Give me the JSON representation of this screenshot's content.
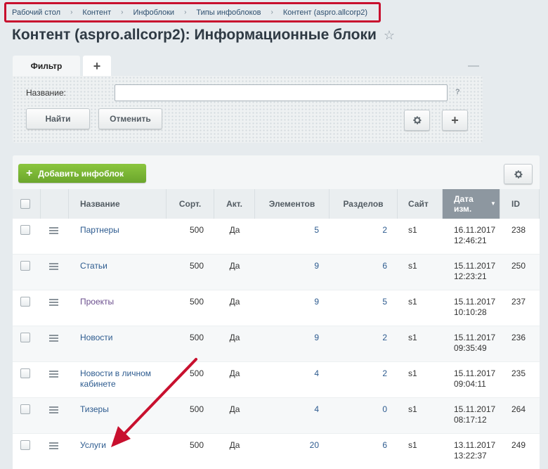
{
  "breadcrumb": [
    "Рабочий стол",
    "Контент",
    "Инфоблоки",
    "Типы инфоблоков",
    "Контент (aspro.allcorp2)"
  ],
  "breadcrumb_separator": "›",
  "page_title": "Контент (aspro.allcorp2): Информационные блоки",
  "filter": {
    "tab_label": "Фильтр",
    "add_tab_label": "+",
    "minimize_label": "—",
    "name_label": "Название:",
    "name_value": "",
    "help_label": "?",
    "find_button": "Найти",
    "cancel_button": "Отменить",
    "plus_button": "+"
  },
  "toolbar": {
    "add_button": "Добавить инфоблок",
    "add_plus": "+"
  },
  "table": {
    "columns": [
      "Название",
      "Сорт.",
      "Акт.",
      "Элементов",
      "Разделов",
      "Сайт",
      "Дата изм.",
      "ID"
    ],
    "sorted_column": "Дата изм.",
    "rows": [
      {
        "name": "Партнеры",
        "sort": "500",
        "active": "Да",
        "elements": "5",
        "sections": "2",
        "site": "s1",
        "date": "16.11.2017 12:46:21",
        "id": "238"
      },
      {
        "name": "Статьи",
        "sort": "500",
        "active": "Да",
        "elements": "9",
        "sections": "6",
        "site": "s1",
        "date": "15.11.2017 12:23:21",
        "id": "250"
      },
      {
        "name": "Проекты",
        "sort": "500",
        "active": "Да",
        "elements": "9",
        "sections": "5",
        "site": "s1",
        "date": "15.11.2017 10:10:28",
        "id": "237"
      },
      {
        "name": "Новости",
        "sort": "500",
        "active": "Да",
        "elements": "9",
        "sections": "2",
        "site": "s1",
        "date": "15.11.2017 09:35:49",
        "id": "236"
      },
      {
        "name": "Новости в личном кабинете",
        "sort": "500",
        "active": "Да",
        "elements": "4",
        "sections": "2",
        "site": "s1",
        "date": "15.11.2017 09:04:11",
        "id": "235"
      },
      {
        "name": "Тизеры",
        "sort": "500",
        "active": "Да",
        "elements": "4",
        "sections": "0",
        "site": "s1",
        "date": "15.11.2017 08:17:12",
        "id": "264"
      },
      {
        "name": "Услуги",
        "sort": "500",
        "active": "Да",
        "elements": "20",
        "sections": "6",
        "site": "s1",
        "date": "13.11.2017 13:22:37",
        "id": "249"
      }
    ]
  },
  "colors": {
    "accent_green": "#7ab535",
    "highlight_border": "#c8102e",
    "arrow": "#c8102e",
    "link": "#2d5b8f"
  },
  "icons": {
    "star": "star-icon",
    "settings": "gear-icon",
    "row_menu": "hamburger-icon"
  }
}
